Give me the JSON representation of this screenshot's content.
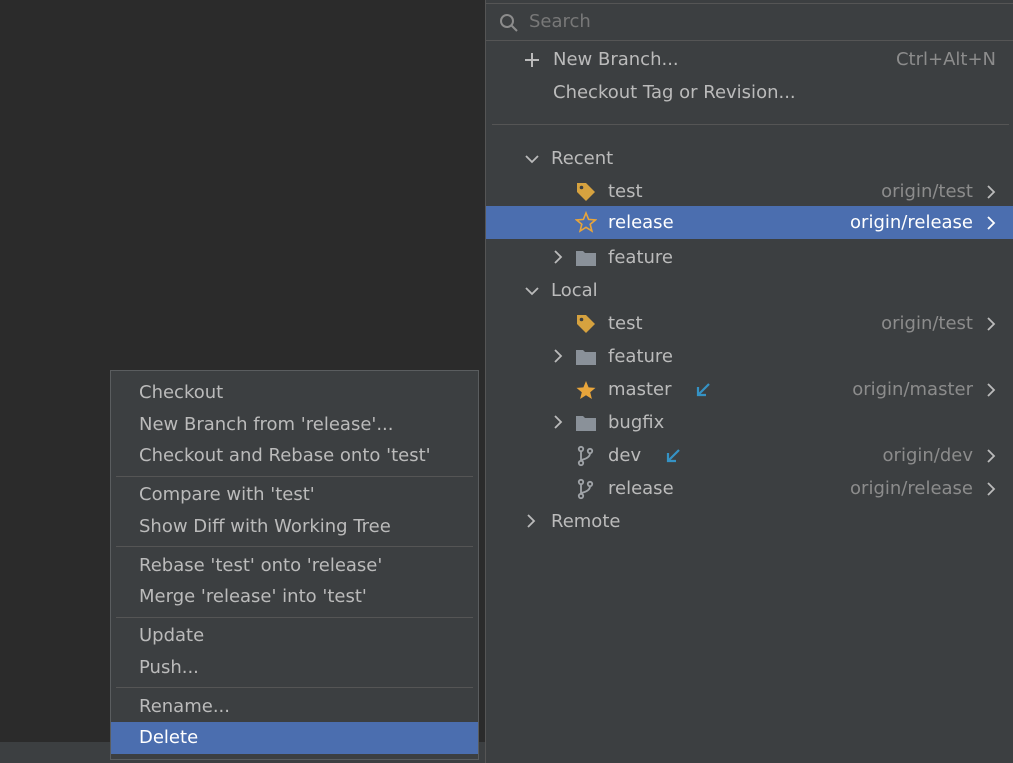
{
  "search": {
    "placeholder": "Search"
  },
  "actions": {
    "new_branch": "New Branch...",
    "new_branch_shortcut": "Ctrl+Alt+N",
    "checkout_tag": "Checkout Tag or Revision..."
  },
  "recent": {
    "label": "Recent",
    "items": [
      {
        "name": "test",
        "remote": "origin/test",
        "icon": "tag-icon"
      },
      {
        "name": "release",
        "remote": "origin/release",
        "icon": "star-outline-icon"
      },
      {
        "name": "feature",
        "icon": "folder-icon"
      }
    ]
  },
  "local": {
    "label": "Local",
    "items": [
      {
        "name": "test",
        "remote": "origin/test",
        "icon": "tag-icon"
      },
      {
        "name": "feature",
        "icon": "folder-icon"
      },
      {
        "name": "master",
        "remote": "origin/master",
        "icon": "star-filled-icon"
      },
      {
        "name": "bugfix",
        "icon": "folder-icon"
      },
      {
        "name": "dev",
        "remote": "origin/dev",
        "icon": "branch-icon"
      },
      {
        "name": "release",
        "remote": "origin/release",
        "icon": "branch-icon"
      }
    ]
  },
  "remote": {
    "label": "Remote"
  },
  "context_menu": {
    "checkout": "Checkout",
    "new_branch_from": "New Branch from 'release'...",
    "checkout_rebase": "Checkout and Rebase onto 'test'",
    "compare": "Compare with 'test'",
    "show_diff": "Show Diff with Working Tree",
    "rebase": "Rebase 'test' onto 'release'",
    "merge": "Merge 'release' into 'test'",
    "update": "Update",
    "push": "Push...",
    "rename": "Rename...",
    "delete": "Delete"
  },
  "colors": {
    "selection": "#4b6eaf",
    "tag": "#d6a23f",
    "star": "#e8a53b",
    "incoming_arrow": "#3592c4"
  }
}
